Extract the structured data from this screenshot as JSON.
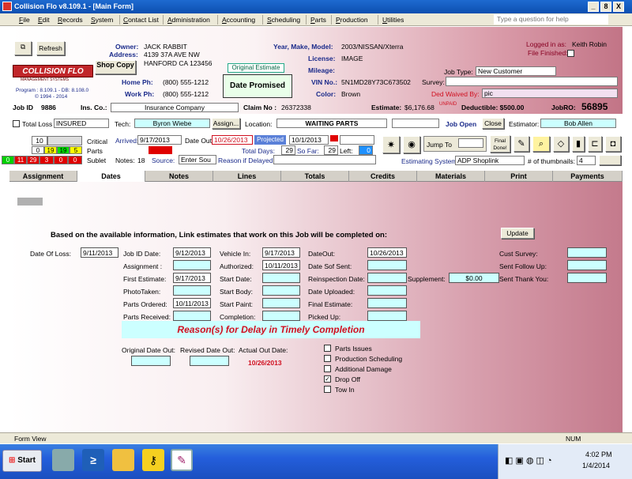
{
  "window": {
    "title": "Collision Flo v8.109.1 - [Main Form]",
    "controls": [
      "_",
      "8",
      "X"
    ]
  },
  "menu": [
    "File",
    "Edit",
    "Records",
    "System",
    "Contact List",
    "Administration",
    "Accounting",
    "Scheduling",
    "Parts",
    "Production",
    "Utilities"
  ],
  "help_placeholder": "Type a question for help",
  "header": {
    "refresh": "Refresh",
    "logo_text": "COLLISION FLO",
    "logo_sub": "MANAGEMENT SYSTEMS",
    "program_line1": "Program : 8.109.1 - DB: 8.108.0",
    "program_line2": "© 1994 - 2014",
    "job_id_label": "Job ID",
    "job_id": "9886",
    "ins_co_label": "Ins. Co.:",
    "ins_co": "Insurance Company",
    "claim_label": "Claim No :",
    "claim_no": "26372338",
    "owner_label": "Owner:",
    "owner": "JACK RABBIT",
    "address_label": "Address:",
    "address1": "4139 37A AVE NW",
    "address2": "HANFORD CA 123456",
    "shop": "Shop Copy",
    "home_label": "Home Ph:",
    "home_ph": "(800) 555-1212",
    "work_label": "Work Ph:",
    "work_ph": "(800) 555-1212",
    "original_estimate": "Original Estimate",
    "date_promised": "Date Promised",
    "ymm_label": "Year, Make, Model:",
    "ymm": "2003/NISSAN/Xterra",
    "license_label": "License:",
    "license": "IMAGE",
    "mileage_label": "Mileage:",
    "vin_label": "VIN No.:",
    "vin": "5N1MD28Y73C673502",
    "color_label": "Color:",
    "color": "Brown",
    "logged_label": "Logged in as:",
    "logged_user": "Keith Robin",
    "file_finished": "File Finished:",
    "job_type_label": "Job Type:",
    "job_type": "New Customer",
    "survey_label": "Survey:",
    "ded_waived_label": "Ded Waived By:",
    "ded_waived": "pic",
    "estimate_label": "Estimate:",
    "estimate": "$6,176.68",
    "unpaid": "UNPAID",
    "deductible": "Deductible: $500.00",
    "jobro_label": "JobRO:",
    "jobro": "56895"
  },
  "row2": {
    "total_loss": "Total Loss",
    "insured": "INSURED",
    "tech_label": "Tech:",
    "tech": "Byron Wiebe",
    "assign": "Assign...",
    "location_label": "Location:",
    "location": "WAITING PARTS",
    "job_open": "Job Open",
    "close": "Close",
    "estimator_label": "Estimator:",
    "estimator": "Bob Allen"
  },
  "row3": {
    "critical": "Critical",
    "parts": "Parts",
    "sublet": "Sublet",
    "crit_count": "10",
    "parts_counts": [
      "0",
      "19",
      "19",
      "5"
    ],
    "sublet_counts": [
      "0",
      "11",
      "29",
      "3",
      "0",
      "0"
    ],
    "notes_label": "Notes:",
    "notes": "18",
    "arrived_label": "Arrived:",
    "arrived": "9/17/2013",
    "date_out_label": "Date Out",
    "date_out": "10/26/2013",
    "projected": "Projected",
    "projected_date": "10/1/2013",
    "total_days_label": "Total Days:",
    "total_days": "29",
    "so_far_label": "So Far:",
    "so_far": "29",
    "left_label": "Left:",
    "left": "0",
    "source_label": "Source:",
    "source": "Enter Sou",
    "reason_delay": "Reason if Delayed:",
    "jump_to": "Jump To",
    "final_done": "Final Done!",
    "est_system_label": "Estimating System:",
    "est_system": "ADP Shoplink",
    "thumbs_label": "# of thumbnails:",
    "thumbs": "4"
  },
  "tabs": [
    "Assignment",
    "Dates",
    "Notes",
    "Lines",
    "Totals",
    "Credits",
    "Materials",
    "Print",
    "Payments"
  ],
  "dates": {
    "headline": "Based on the available information, Link estimates that work on this Job will be completed on:",
    "update": "Update",
    "date_of_loss_label": "Date Of Loss:",
    "date_of_loss": "9/11/2013",
    "col1": [
      {
        "label": "Job ID Date:",
        "value": "9/12/2013"
      },
      {
        "label": "Assignment :",
        "value": ""
      },
      {
        "label": "First Estimate:",
        "value": "9/17/2013"
      },
      {
        "label": "PhotoTaken:",
        "value": ""
      },
      {
        "label": "Parts Ordered:",
        "value": "10/11/2013"
      },
      {
        "label": "Parts Received:",
        "value": ""
      }
    ],
    "col2": [
      {
        "label": "Vehicle In:",
        "value": "9/17/2013"
      },
      {
        "label": "Authorized:",
        "value": "10/11/2013"
      },
      {
        "label": "Start Date:",
        "value": ""
      },
      {
        "label": "Start Body:",
        "value": ""
      },
      {
        "label": "Start Paint:",
        "value": ""
      },
      {
        "label": "Completion:",
        "value": ""
      }
    ],
    "col3": [
      {
        "label": "DateOut:",
        "value": "10/26/2013"
      },
      {
        "label": "Date Sof Sent:",
        "value": ""
      },
      {
        "label": "Reinspection Date:",
        "value": ""
      },
      {
        "label": "Date Uploaded:",
        "value": ""
      },
      {
        "label": "Final Estimate:",
        "value": ""
      },
      {
        "label": "Picked Up:",
        "value": ""
      }
    ],
    "supplement_label": "Supplement:",
    "supplement": "$0.00",
    "col4": [
      {
        "label": "Cust Survey:",
        "value": ""
      },
      {
        "label": "Sent Follow Up:",
        "value": ""
      },
      {
        "label": "Sent Thank You:",
        "value": ""
      }
    ],
    "reasons_title": "Reason(s) for Delay in Timely Completion",
    "orig_out_label": "Original Date Out:",
    "rev_out_label": "Revised Date Out:",
    "actual_out_label": "Actual Out Date:",
    "actual_out": "10/26/2013",
    "checks": [
      {
        "label": "Parts Issues",
        "checked": false
      },
      {
        "label": "Production Scheduling",
        "checked": false
      },
      {
        "label": "Additional Damage",
        "checked": false
      },
      {
        "label": "Drop Off",
        "checked": true
      },
      {
        "label": "Tow In",
        "checked": false
      }
    ]
  },
  "status": {
    "left": "Form View",
    "right": "NUM"
  },
  "taskbar": {
    "start": "Start",
    "time": "4:02 PM",
    "date": "1/4/2014"
  }
}
